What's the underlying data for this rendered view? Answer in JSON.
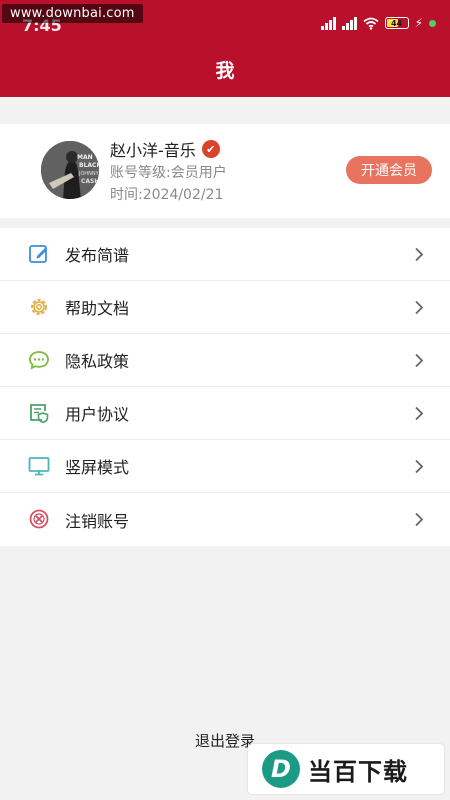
{
  "status_bar": {
    "watermark": "www.downbai.com",
    "time": "7:45",
    "battery": "44"
  },
  "header": {
    "title": "我"
  },
  "profile": {
    "name": "赵小洋-音乐",
    "verified_mark": "✔",
    "level": "账号等级:会员用户",
    "date": "时间:2024/02/21",
    "vip_button": "开通会员"
  },
  "menu": {
    "items": [
      {
        "label": "发布简谱",
        "icon": "edit-icon",
        "color": "#3b8fd6"
      },
      {
        "label": "帮助文档",
        "icon": "gear-icon",
        "color": "#e0a93a"
      },
      {
        "label": "隐私政策",
        "icon": "chat-bubble-icon",
        "color": "#7cbb3e"
      },
      {
        "label": "用户协议",
        "icon": "document-shield-icon",
        "color": "#4aa26a"
      },
      {
        "label": "竖屏模式",
        "icon": "monitor-icon",
        "color": "#4bb7b4"
      },
      {
        "label": "注销账号",
        "icon": "cancel-circle-icon",
        "color": "#d25163"
      }
    ]
  },
  "logout": {
    "label": "退出登录"
  },
  "brand": {
    "logo_letter": "D",
    "text": "当百下载"
  },
  "colors": {
    "header_bg": "#b9102c",
    "vip_button_bg": "#e8735f"
  }
}
